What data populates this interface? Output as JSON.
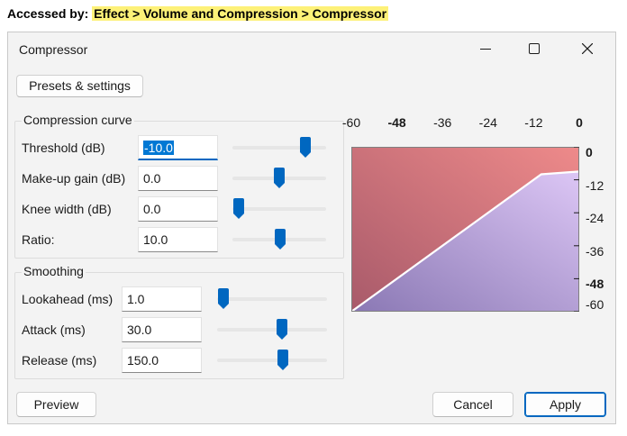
{
  "caption": {
    "prefix": "Accessed by:",
    "path": "Effect > Volume and Compression > Compressor"
  },
  "window": {
    "title": "Compressor",
    "controls": [
      "minimize-icon",
      "maximize-icon",
      "close-icon"
    ]
  },
  "presets_button": "Presets & settings",
  "compression": {
    "legend": "Compression curve",
    "rows": [
      {
        "label": "Threshold (dB)",
        "value": "-10.0",
        "slider": 0.82
      },
      {
        "label": "Make-up gain (dB)",
        "value": "0.0",
        "slider": 0.5
      },
      {
        "label": "Knee width (dB)",
        "value": "0.0",
        "slider": 0.0
      },
      {
        "label": "Ratio:",
        "value": "10.0",
        "slider": 0.51
      }
    ]
  },
  "smoothing": {
    "legend": "Smoothing",
    "rows": [
      {
        "label": "Lookahead (ms)",
        "value": "1.0",
        "slider": 0.0
      },
      {
        "label": "Attack (ms)",
        "value": "30.0",
        "slider": 0.6
      },
      {
        "label": "Release (ms)",
        "value": "150.0",
        "slider": 0.61
      }
    ]
  },
  "graph": {
    "top_axis": [
      {
        "label": "-60",
        "value": -60,
        "bold": false
      },
      {
        "label": "-48",
        "value": -48,
        "bold": true
      },
      {
        "label": "-36",
        "value": -36,
        "bold": false
      },
      {
        "label": "-24",
        "value": -24,
        "bold": false
      },
      {
        "label": "-12",
        "value": -12,
        "bold": false
      },
      {
        "label": "0",
        "value": 0,
        "bold": true
      }
    ],
    "right_axis": [
      {
        "label": "0",
        "value": 0,
        "bold": true
      },
      {
        "label": "-12",
        "value": -12,
        "bold": false
      },
      {
        "label": "-24",
        "value": -24,
        "bold": false
      },
      {
        "label": "-36",
        "value": -36,
        "bold": false
      },
      {
        "label": "-48",
        "value": -48,
        "bold": true
      },
      {
        "label": "-60",
        "value": -60,
        "bold": false
      }
    ],
    "curve_db": [
      [
        -60,
        -60
      ],
      [
        -10,
        -10
      ],
      [
        0,
        -9
      ]
    ],
    "colors": {
      "upper": "#d88080",
      "lower": "#b9a0d8",
      "line": "#ffffff"
    }
  },
  "buttons": {
    "preview": "Preview",
    "cancel": "Cancel",
    "apply": "Apply"
  }
}
